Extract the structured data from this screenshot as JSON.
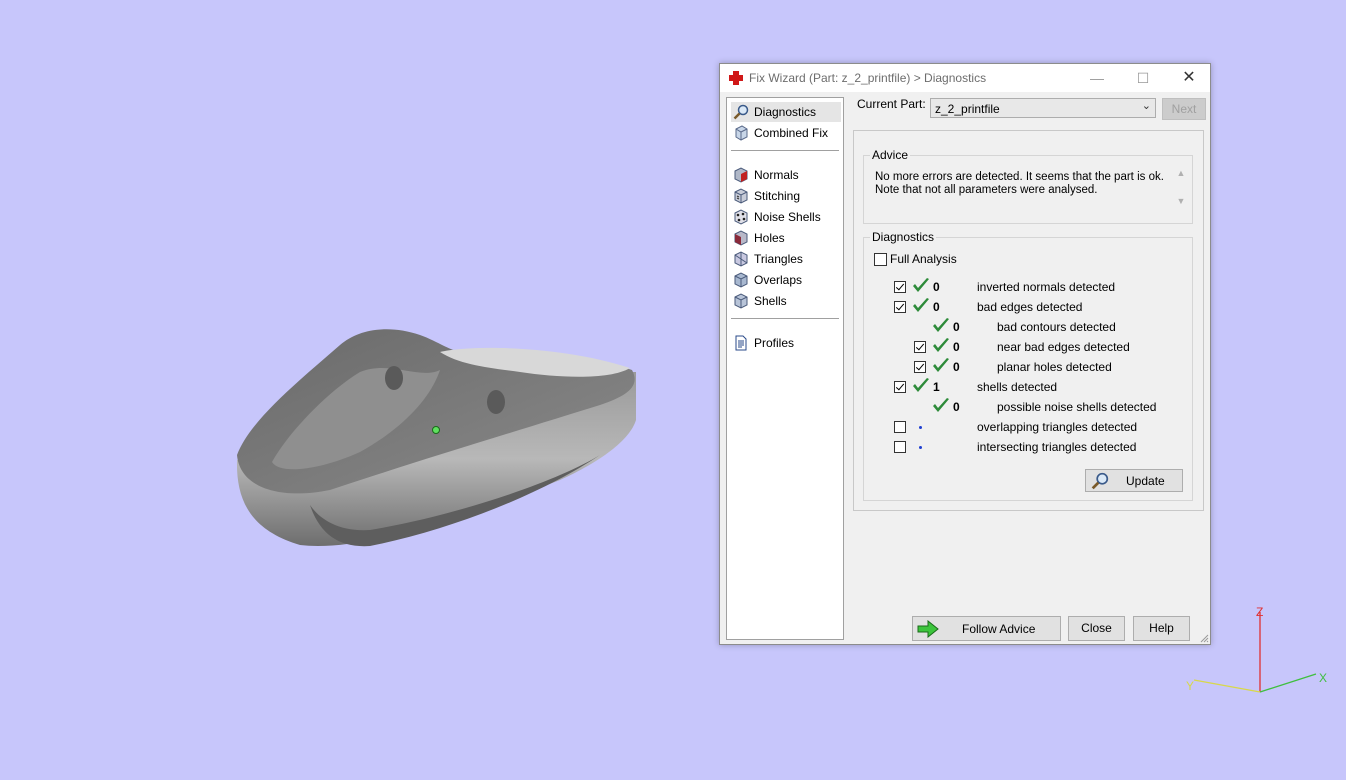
{
  "window": {
    "title": "Fix Wizard (Part: z_2_printfile) > Diagnostics",
    "minimize": "—",
    "maximize": "☐",
    "close": "✕"
  },
  "nav": {
    "items": [
      {
        "label": "Diagnostics",
        "icon": "magnifier-icon",
        "selected": true
      },
      {
        "label": "Combined Fix",
        "icon": "cube-icon"
      },
      {
        "label": "Normals",
        "icon": "normals-cube-icon"
      },
      {
        "label": "Stitching",
        "icon": "stitching-cube-icon"
      },
      {
        "label": "Noise Shells",
        "icon": "noise-shells-icon"
      },
      {
        "label": "Holes",
        "icon": "holes-cube-icon"
      },
      {
        "label": "Triangles",
        "icon": "triangles-cube-icon"
      },
      {
        "label": "Overlaps",
        "icon": "overlaps-cube-icon"
      },
      {
        "label": "Shells",
        "icon": "shells-cube-icon"
      },
      {
        "label": "Profiles",
        "icon": "document-icon"
      }
    ]
  },
  "current_part": {
    "label": "Current Part:",
    "value": "z_2_printfile",
    "next_label": "Next"
  },
  "advice": {
    "title": "Advice",
    "line1": "No more errors are detected. It seems that the part is ok.",
    "line2": "Note that not all parameters were analysed."
  },
  "diagnostics": {
    "title": "Diagnostics",
    "full_analysis_label": "Full Analysis",
    "full_analysis_checked": false,
    "rows": [
      {
        "checkbox": true,
        "checked": true,
        "status": "ok",
        "count": "0",
        "label": "inverted normals detected",
        "indent": 0
      },
      {
        "checkbox": true,
        "checked": true,
        "status": "ok",
        "count": "0",
        "label": "bad edges detected",
        "indent": 0
      },
      {
        "checkbox": false,
        "checked": false,
        "status": "ok",
        "count": "0",
        "label": "bad contours detected",
        "indent": 1
      },
      {
        "checkbox": true,
        "checked": true,
        "status": "ok",
        "count": "0",
        "label": "near bad edges detected",
        "indent": 1
      },
      {
        "checkbox": true,
        "checked": true,
        "status": "ok",
        "count": "0",
        "label": "planar holes detected",
        "indent": 1
      },
      {
        "checkbox": true,
        "checked": true,
        "status": "ok",
        "count": "1",
        "label": "shells detected",
        "indent": 0
      },
      {
        "checkbox": false,
        "checked": false,
        "status": "ok",
        "count": "0",
        "label": "possible noise shells detected",
        "indent": 1
      },
      {
        "checkbox": true,
        "checked": false,
        "status": "pending",
        "count": "",
        "label": "overlapping triangles detected",
        "indent": 0
      },
      {
        "checkbox": true,
        "checked": false,
        "status": "pending",
        "count": "",
        "label": "intersecting triangles detected",
        "indent": 0
      }
    ],
    "update_label": "Update"
  },
  "footer": {
    "follow_advice_label": "Follow Advice",
    "close_label": "Close",
    "help_label": "Help"
  },
  "axes": {
    "x": "X",
    "y": "Y",
    "z": "Z"
  },
  "colors": {
    "background": "#c7c6fb",
    "tick_green": "#2e8b3a",
    "part_gray": "#7d7d7d",
    "axis_x": "#3fbf3f",
    "axis_y": "#d8d84a",
    "axis_z": "#e03030"
  }
}
